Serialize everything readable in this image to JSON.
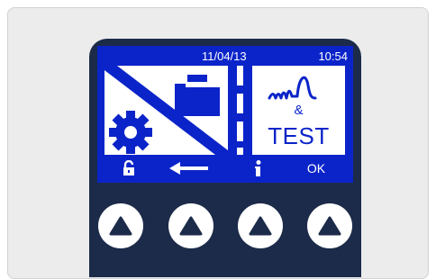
{
  "screen": {
    "date": "11/04/13",
    "time": "10:54",
    "right_tile": {
      "line1": "&",
      "line2": "TEST"
    },
    "softkeys": {
      "ok_label": "OK"
    }
  },
  "colors": {
    "screen_blue": "#0b24c9",
    "bezel": "#1c2b49",
    "panel": "#ececec",
    "white": "#ffffff"
  },
  "icons": {
    "left_tile": [
      "folder-icon",
      "gear-icon"
    ],
    "right_tile": [
      "waveform-icon"
    ],
    "softkeys": [
      "unlock-icon",
      "arrow-left-icon",
      "info-icon"
    ],
    "buttons": [
      "triangle-up-icon"
    ]
  }
}
